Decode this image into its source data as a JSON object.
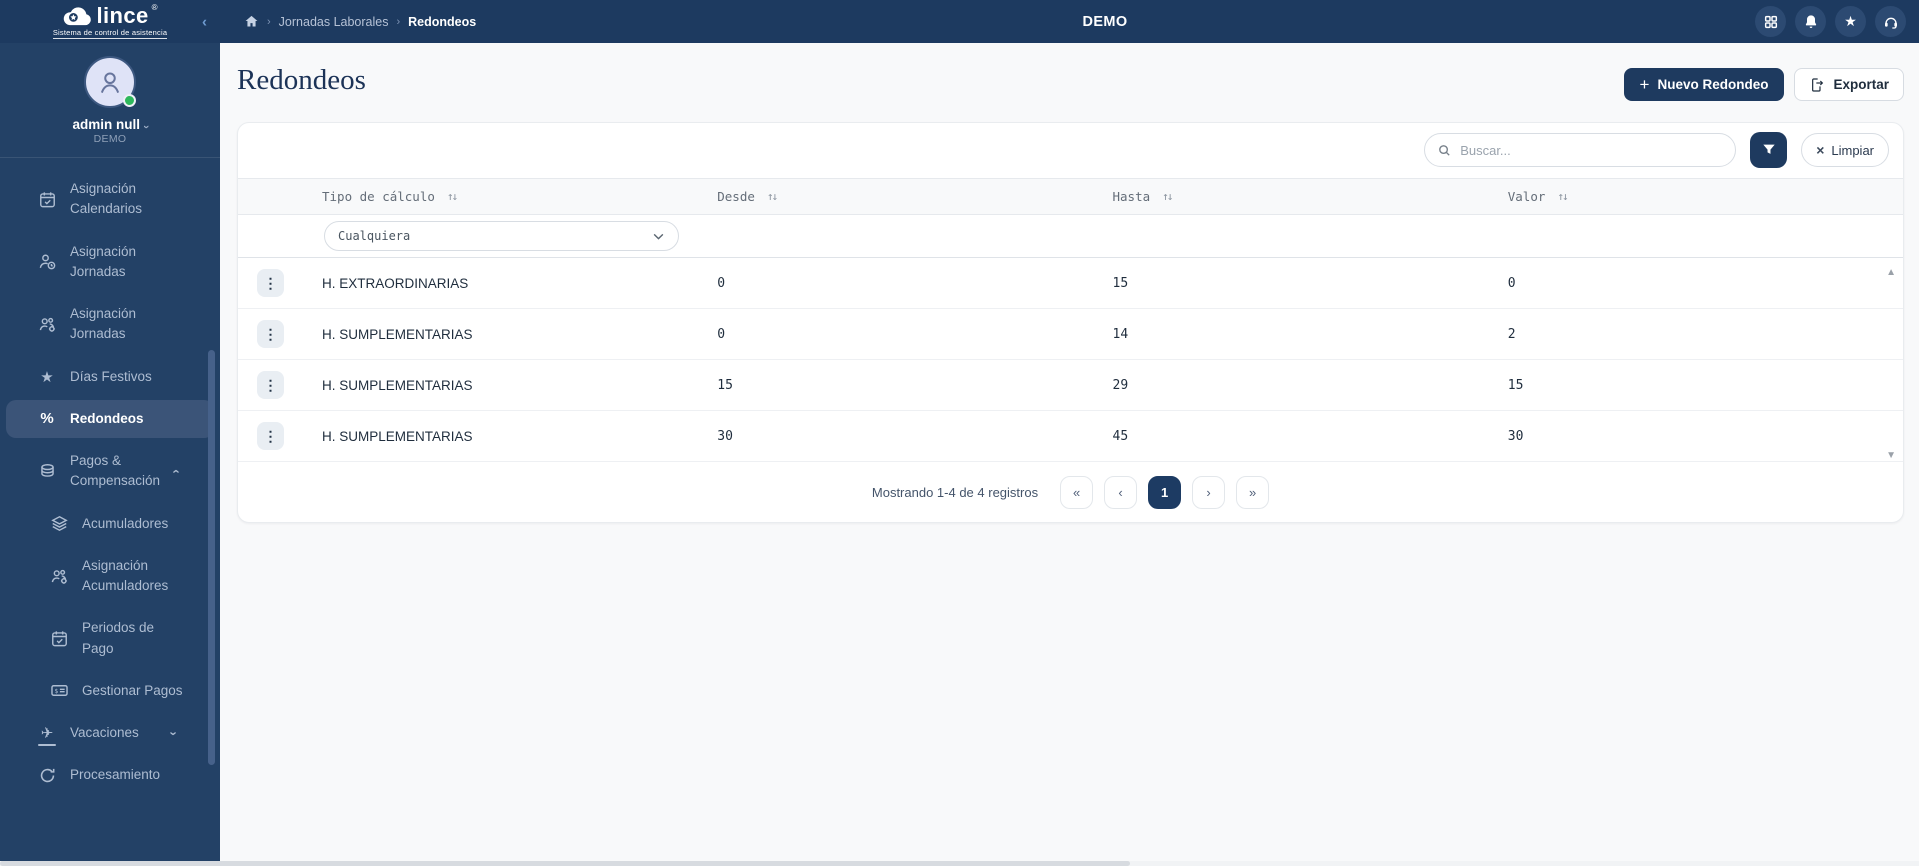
{
  "header": {
    "logo_name": "lince",
    "logo_mark": "®",
    "logo_tagline": "Sistema de control de asistencia",
    "breadcrumb": [
      "Jornadas Laborales",
      "Redondeos"
    ],
    "env_title": "DEMO",
    "icon_names": [
      "apps-grid-icon",
      "notifications-bell-icon",
      "favorites-star-icon",
      "support-headset-icon"
    ]
  },
  "sidebar": {
    "user_name": "admin null",
    "user_org": "DEMO",
    "items": [
      {
        "label": "Asignación Calendarios",
        "icon": "calendar-check"
      },
      {
        "label": "Asignación Jornadas",
        "icon": "user-clock"
      },
      {
        "label": "Asignación Jornadas",
        "icon": "users-gear"
      },
      {
        "label": "Días Festivos",
        "icon": "star"
      },
      {
        "label": "Redondeos",
        "icon": "percent",
        "active": true
      },
      {
        "label": "Pagos & Compensación",
        "icon": "coins",
        "expanded": true
      },
      {
        "label": "Acumuladores",
        "icon": "layers",
        "sub": true
      },
      {
        "label": "Asignación Acumuladores",
        "icon": "users-gear",
        "sub": true
      },
      {
        "label": "Periodos de Pago",
        "icon": "calendar-check",
        "sub": true
      },
      {
        "label": "Gestionar Pagos",
        "icon": "money-check",
        "sub": true
      },
      {
        "label": "Vacaciones",
        "icon": "plane",
        "collapsed": true
      },
      {
        "label": "Procesamiento",
        "icon": "sync"
      }
    ]
  },
  "page": {
    "title": "Redondeos",
    "new_button": "Nuevo Redondeo",
    "export_button": "Exportar"
  },
  "toolbar": {
    "search_placeholder": "Buscar...",
    "clear_button": "Limpiar"
  },
  "table": {
    "columns": [
      "Tipo de cálculo",
      "Desde",
      "Hasta",
      "Valor"
    ],
    "filter_value": "Cualquiera",
    "rows": [
      {
        "tipo": "H. EXTRAORDINARIAS",
        "desde": "0",
        "hasta": "15",
        "valor": "0"
      },
      {
        "tipo": "H. SUMPLEMENTARIAS",
        "desde": "0",
        "hasta": "14",
        "valor": "2"
      },
      {
        "tipo": "H. SUMPLEMENTARIAS",
        "desde": "15",
        "hasta": "29",
        "valor": "15"
      },
      {
        "tipo": "H. SUMPLEMENTARIAS",
        "desde": "30",
        "hasta": "45",
        "valor": "30"
      }
    ]
  },
  "pagination": {
    "summary": "Mostrando 1-4 de 4 registros",
    "page": "1"
  },
  "icons": {
    "sort": "↑↓",
    "kebab": "⋮",
    "plus": "+",
    "close": "×",
    "chevron": "›",
    "collapse": "‹",
    "first": "«",
    "prev": "‹",
    "next": "›",
    "last": "»",
    "star": "★",
    "percent": "%",
    "plane": "✈",
    "up_arrow": "▲",
    "down_arrow": "▼"
  },
  "colors": {
    "header_navy": "#1d3a60",
    "sidebar_navy": "#234166",
    "active_item": "#3b5478",
    "accent_navy": "#1e3a5f",
    "success_green": "#2eb85c",
    "page_bg": "#f8f9fa"
  }
}
